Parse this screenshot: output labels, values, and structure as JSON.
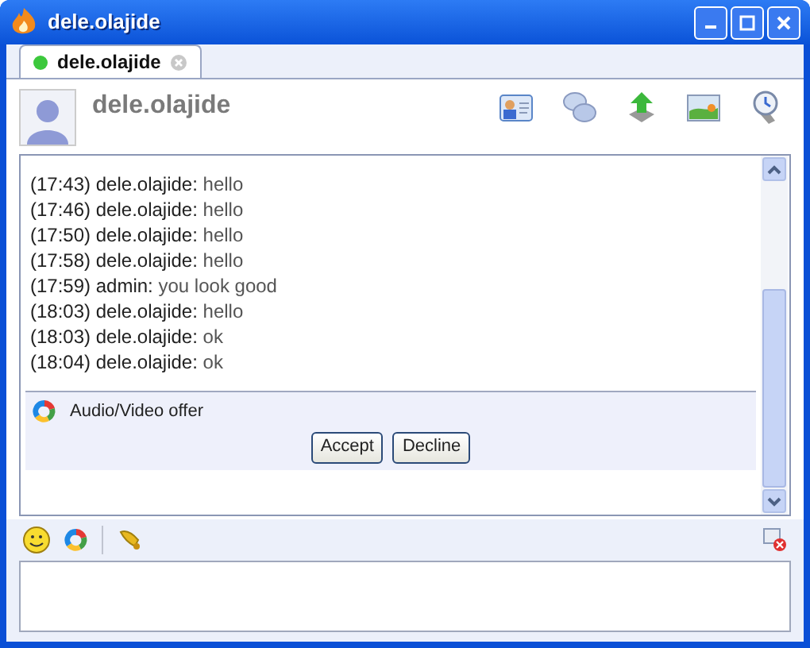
{
  "window": {
    "title": "dele.olajide"
  },
  "tabs": [
    {
      "label": "dele.olajide",
      "selected": true,
      "online": true
    }
  ],
  "contact": {
    "name": "dele.olajide"
  },
  "messages": [
    {
      "time": "(17:43)",
      "sender": "dele.olajide:",
      "text": "hello"
    },
    {
      "time": "(17:46)",
      "sender": "dele.olajide:",
      "text": "hello"
    },
    {
      "time": "(17:50)",
      "sender": "dele.olajide:",
      "text": "hello"
    },
    {
      "time": "(17:58)",
      "sender": "dele.olajide:",
      "text": "hello"
    },
    {
      "time": "(17:59)",
      "sender": "admin:",
      "text": "you look good"
    },
    {
      "time": "(18:03)",
      "sender": "dele.olajide:",
      "text": "hello"
    },
    {
      "time": "(18:03)",
      "sender": "dele.olajide:",
      "text": "ok"
    },
    {
      "time": "(18:04)",
      "sender": "dele.olajide:",
      "text": "ok"
    }
  ],
  "offer": {
    "title": "Audio/Video offer",
    "buttons": [
      "Accept",
      "Decline"
    ]
  }
}
